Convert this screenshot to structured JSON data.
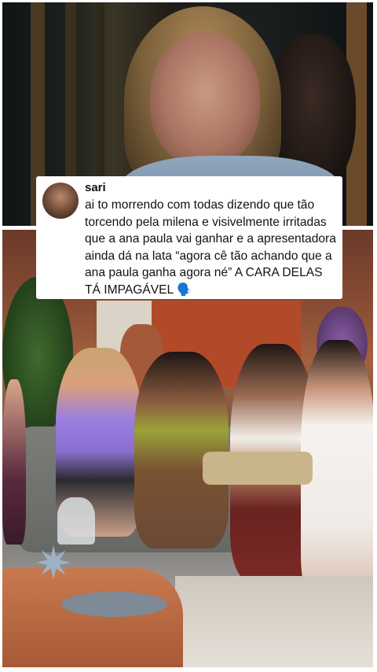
{
  "tweet": {
    "username": "sari",
    "text": "ai to morrendo com todas dizendo que tão torcendo pela milena e visivelmente irritadas que a ana paula vai ganhar e a apresentadora ainda dá na lata “agora cê tão achando que a ana paula ganha agora né” A CARA DELAS TÁ IMPAGÁVEL 🗣️"
  }
}
